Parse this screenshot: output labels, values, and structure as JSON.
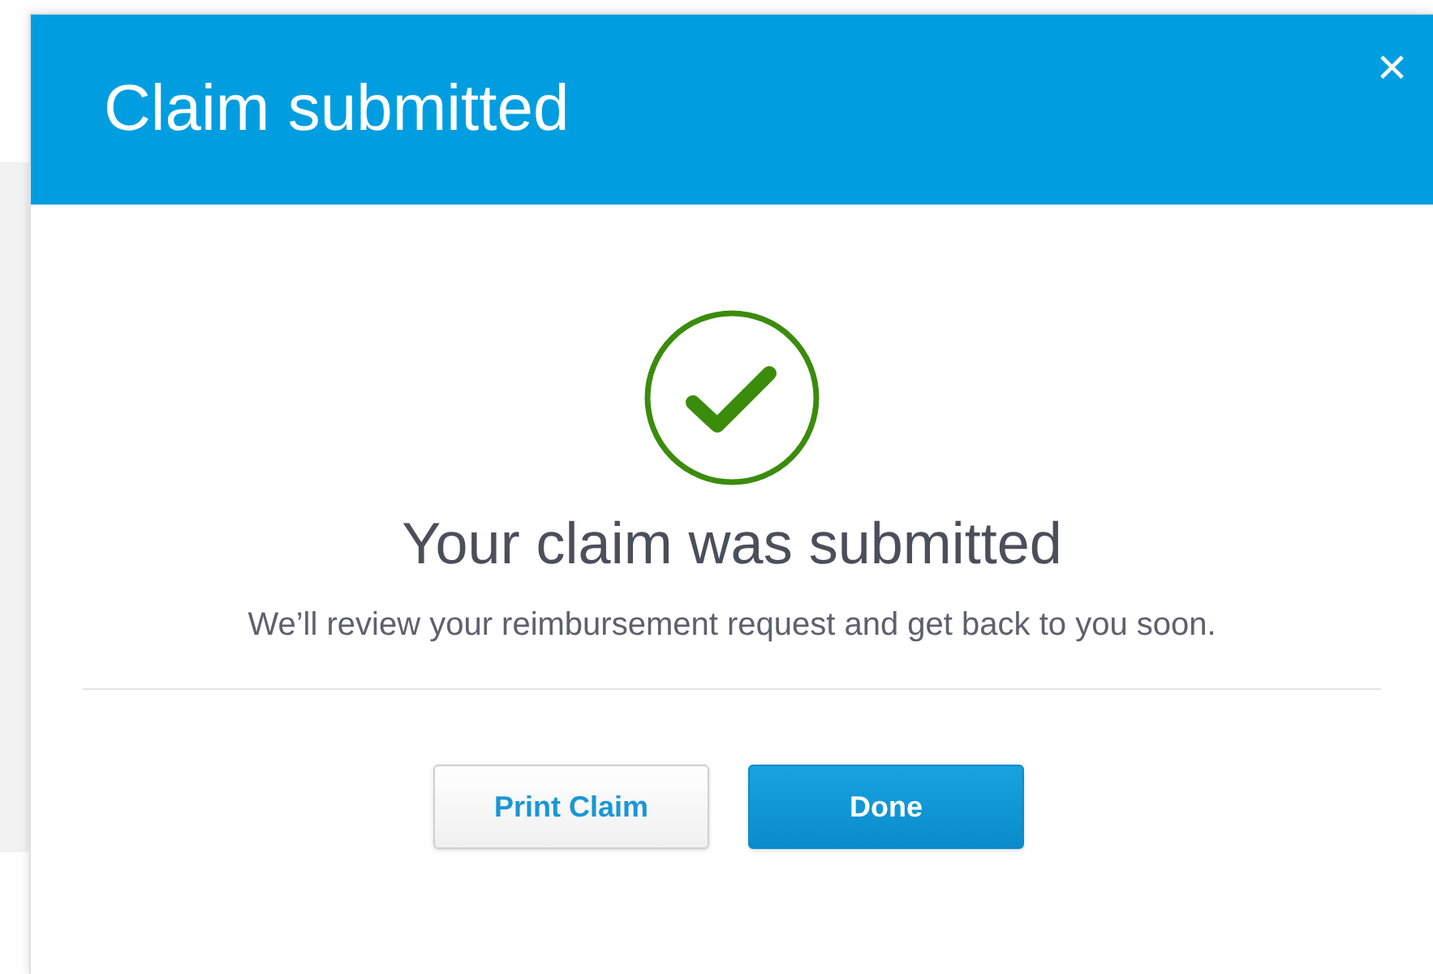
{
  "dialog": {
    "title": "Claim submitted",
    "close": "×"
  },
  "message": {
    "heading": "Your claim was submitted",
    "body": "We’ll review your reimbursement request and get back to you soon."
  },
  "buttons": [
    {
      "label": "Print Claim",
      "kind": "secondary"
    },
    {
      "label": "Done",
      "kind": "primary"
    }
  ]
}
